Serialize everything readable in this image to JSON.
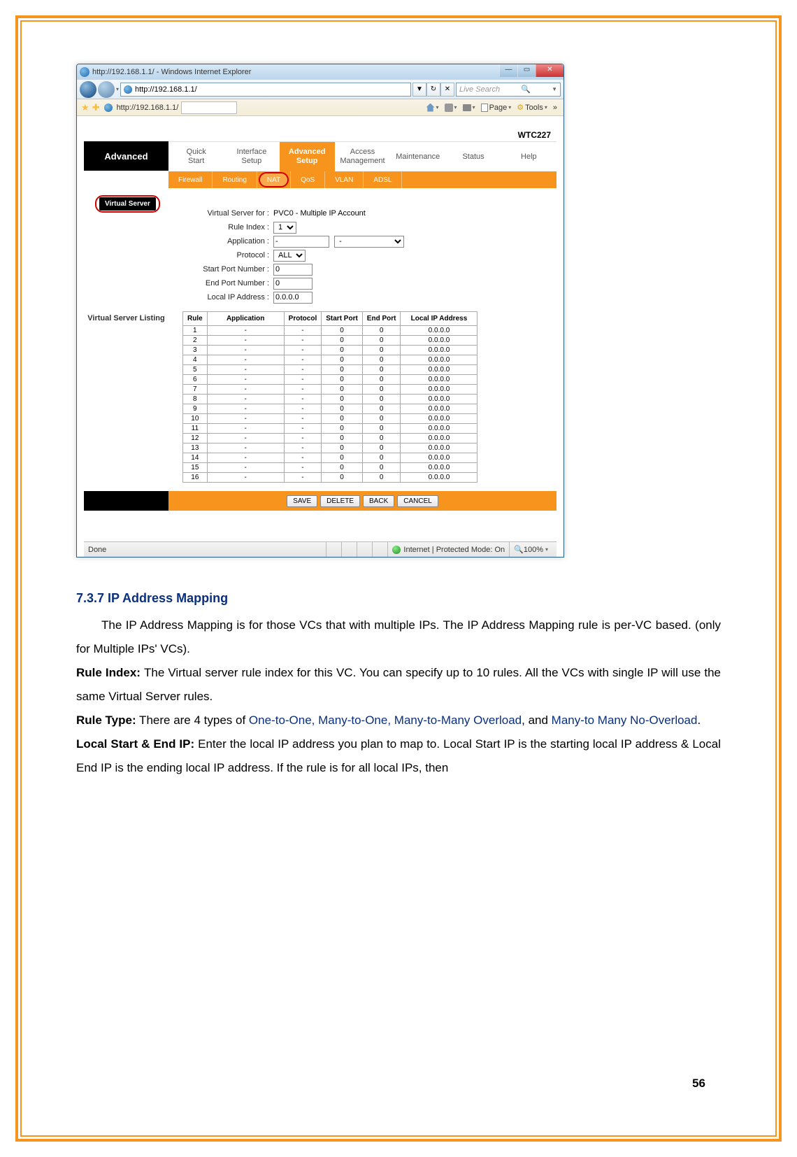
{
  "titlebar": {
    "text": "http://192.168.1.1/ - Windows Internet Explorer"
  },
  "win_buttons": {
    "min": "—",
    "max": "▭",
    "close": "✕"
  },
  "address_bar": {
    "url": "http://192.168.1.1/"
  },
  "addr_dropdown_glyph": "▼",
  "addr_refresh_glyph": "↻",
  "addr_stop_glyph": "✕",
  "search": {
    "placeholder": "Live Search",
    "mag": "🔍",
    "arrow": "▼"
  },
  "fav": {
    "tab_title": "http://192.168.1.1/",
    "page_label": "Page",
    "tools_label": "Tools",
    "chevrons": "»"
  },
  "router": {
    "model": "WTC227",
    "advanced_label": "Advanced",
    "nav_tabs": [
      {
        "l1": "Quick",
        "l2": "Start"
      },
      {
        "l1": "Interface",
        "l2": "Setup"
      },
      {
        "l1": "Advanced",
        "l2": "Setup"
      },
      {
        "l1": "Access",
        "l2": "Management"
      },
      {
        "l1": "Maintenance",
        "l2": ""
      },
      {
        "l1": "Status",
        "l2": ""
      },
      {
        "l1": "Help",
        "l2": ""
      }
    ],
    "sub_items": [
      "Firewall",
      "Routing",
      "NAT",
      "QoS",
      "VLAN",
      "ADSL"
    ],
    "vs_badge": "Virtual Server",
    "form": {
      "for_label": "Virtual Server for :",
      "for_value": "PVC0 - Multiple IP Account",
      "rule_index_label": "Rule Index :",
      "rule_index_value": "1",
      "application_label": "Application :",
      "application_value": "-",
      "application_select": "-",
      "protocol_label": "Protocol :",
      "protocol_value": "ALL",
      "start_port_label": "Start Port Number :",
      "start_port_value": "0",
      "end_port_label": "End Port Number :",
      "end_port_value": "0",
      "local_ip_label": "Local IP Address :",
      "local_ip_value": "0.0.0.0"
    },
    "listing_label": "Virtual Server Listing",
    "table_headers": [
      "Rule",
      "Application",
      "Protocol",
      "Start Port",
      "End Port",
      "Local IP Address"
    ],
    "table_rows": [
      {
        "rule": "1",
        "app": "-",
        "proto": "-",
        "sp": "0",
        "ep": "0",
        "ip": "0.0.0.0"
      },
      {
        "rule": "2",
        "app": "-",
        "proto": "-",
        "sp": "0",
        "ep": "0",
        "ip": "0.0.0.0"
      },
      {
        "rule": "3",
        "app": "-",
        "proto": "-",
        "sp": "0",
        "ep": "0",
        "ip": "0.0.0.0"
      },
      {
        "rule": "4",
        "app": "-",
        "proto": "-",
        "sp": "0",
        "ep": "0",
        "ip": "0.0.0.0"
      },
      {
        "rule": "5",
        "app": "-",
        "proto": "-",
        "sp": "0",
        "ep": "0",
        "ip": "0.0.0.0"
      },
      {
        "rule": "6",
        "app": "-",
        "proto": "-",
        "sp": "0",
        "ep": "0",
        "ip": "0.0.0.0"
      },
      {
        "rule": "7",
        "app": "-",
        "proto": "-",
        "sp": "0",
        "ep": "0",
        "ip": "0.0.0.0"
      },
      {
        "rule": "8",
        "app": "-",
        "proto": "-",
        "sp": "0",
        "ep": "0",
        "ip": "0.0.0.0"
      },
      {
        "rule": "9",
        "app": "-",
        "proto": "-",
        "sp": "0",
        "ep": "0",
        "ip": "0.0.0.0"
      },
      {
        "rule": "10",
        "app": "-",
        "proto": "-",
        "sp": "0",
        "ep": "0",
        "ip": "0.0.0.0"
      },
      {
        "rule": "11",
        "app": "-",
        "proto": "-",
        "sp": "0",
        "ep": "0",
        "ip": "0.0.0.0"
      },
      {
        "rule": "12",
        "app": "-",
        "proto": "-",
        "sp": "0",
        "ep": "0",
        "ip": "0.0.0.0"
      },
      {
        "rule": "13",
        "app": "-",
        "proto": "-",
        "sp": "0",
        "ep": "0",
        "ip": "0.0.0.0"
      },
      {
        "rule": "14",
        "app": "-",
        "proto": "-",
        "sp": "0",
        "ep": "0",
        "ip": "0.0.0.0"
      },
      {
        "rule": "15",
        "app": "-",
        "proto": "-",
        "sp": "0",
        "ep": "0",
        "ip": "0.0.0.0"
      },
      {
        "rule": "16",
        "app": "-",
        "proto": "-",
        "sp": "0",
        "ep": "0",
        "ip": "0.0.0.0"
      }
    ],
    "buttons": {
      "save": "SAVE",
      "delete": "DELETE",
      "back": "BACK",
      "cancel": "CANCEL"
    }
  },
  "status": {
    "done": "Done",
    "mode": "Internet | Protected Mode: On",
    "zoom": "100%"
  },
  "doc": {
    "heading": "7.3.7 IP Address Mapping",
    "p1a": "The IP Address Mapping is for those VCs that with multiple IPs. The IP Address Mapping rule is per-VC based. (only for Multiple IPs' VCs).",
    "p2_lead": "Rule Index: ",
    "p2_body": " The Virtual server rule index for this VC. You can specify up to 10 rules. All the VCs with single IP will use the same Virtual Server rules.",
    "p3_lead": "Rule Type:",
    "p3_body1": " There are 4 types of ",
    "p3_types": "One-to-One, Many-to-One, Many-to-Many Overload",
    "p3_body2": ", and ",
    "p3_type4": "Many-to Many No-Overload",
    "p3_period": ".",
    "p4_lead": "Local Start & End IP:",
    "p4_body": " Enter the local IP address you plan to map to. Local Start IP is the starting local IP address & Local End IP is the ending local IP address. If the rule is for all local IPs, then"
  },
  "page_number": "56"
}
